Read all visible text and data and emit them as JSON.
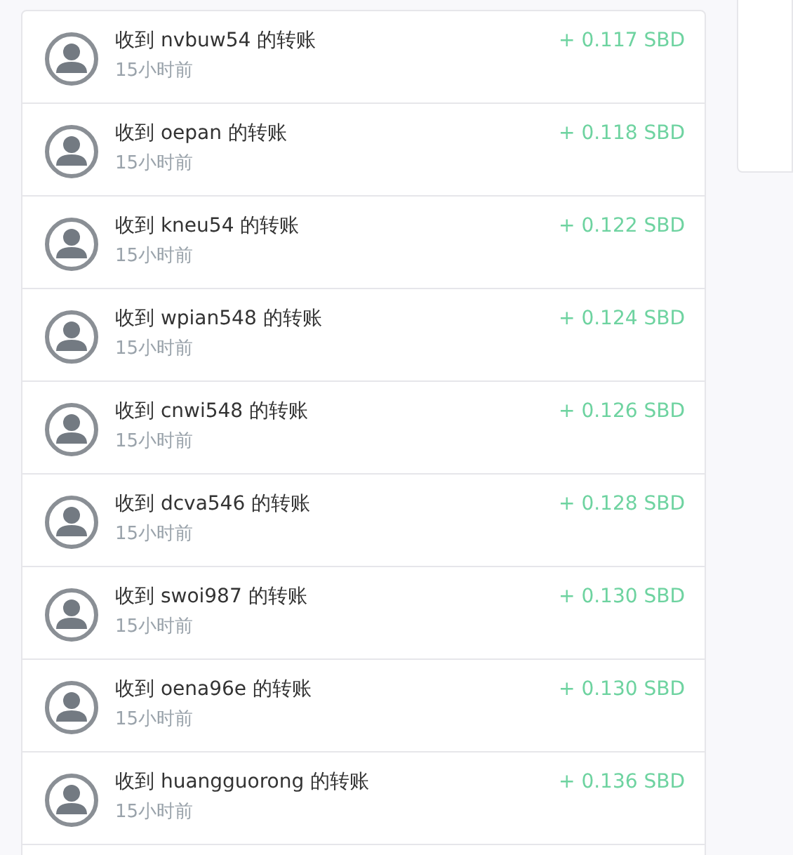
{
  "transfers": [
    {
      "title": "收到 nvbuw54 的转账",
      "time": "15小时前",
      "amount": "+ 0.117 SBD"
    },
    {
      "title": "收到 oepan 的转账",
      "time": "15小时前",
      "amount": "+ 0.118 SBD"
    },
    {
      "title": "收到 kneu54 的转账",
      "time": "15小时前",
      "amount": "+ 0.122 SBD"
    },
    {
      "title": "收到 wpian548 的转账",
      "time": "15小时前",
      "amount": "+ 0.124 SBD"
    },
    {
      "title": "收到 cnwi548 的转账",
      "time": "15小时前",
      "amount": "+ 0.126 SBD"
    },
    {
      "title": "收到 dcva546 的转账",
      "time": "15小时前",
      "amount": "+ 0.128 SBD"
    },
    {
      "title": "收到 swoi987 的转账",
      "time": "15小时前",
      "amount": "+ 0.130 SBD"
    },
    {
      "title": "收到 oena96e 的转账",
      "time": "15小时前",
      "amount": "+ 0.130 SBD"
    },
    {
      "title": "收到 huangguorong 的转账",
      "time": "15小时前",
      "amount": "+ 0.136 SBD"
    }
  ]
}
